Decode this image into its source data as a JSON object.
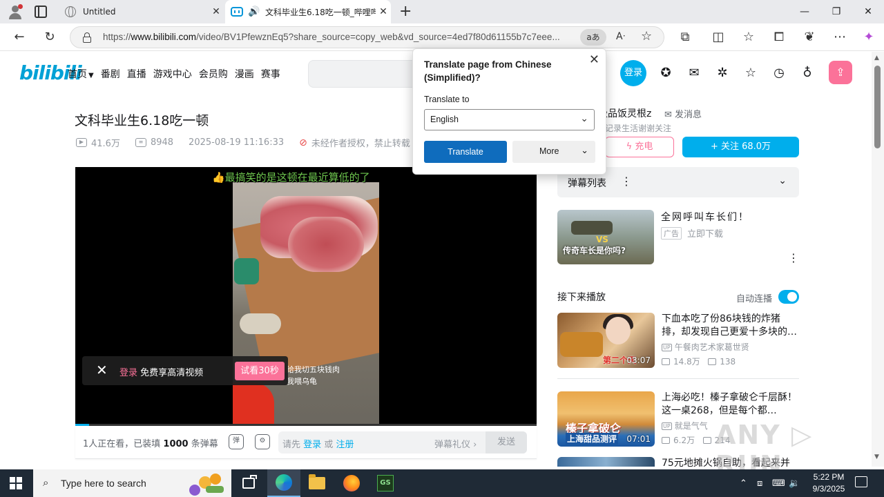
{
  "browser": {
    "tabs": [
      {
        "title": "Untitled"
      },
      {
        "title": "文科毕业生6.18吃一顿_哔哩哔"
      }
    ],
    "address": {
      "url_prefix": "https://",
      "url_host": "www.bilibili.com",
      "url_path": "/video/BV1PfewznEq5?share_source=copy_web&vd_source=4ed7f80d61155b7c7eee...",
      "read_aloud": "aあ"
    }
  },
  "site": {
    "logo": "bilibili",
    "nav": [
      "首页",
      "番剧",
      "直播",
      "游戏中心",
      "会员购",
      "漫画",
      "赛事"
    ],
    "login": "登录"
  },
  "video": {
    "title": "文科毕业生6.18吃一顿",
    "views": "41.6万",
    "danmaku_count": "8948",
    "datetime": "2025-08-19 11:16:33",
    "copyright": "未经作者授权，禁止转载",
    "overlay_danmaku": "👍最搞笑的是这顿在最近算低的了",
    "subtitle_line1": "给我切五块钱肉",
    "subtitle_line2": "我喂乌龟",
    "login_banner_prefix": "登录",
    "login_banner_text": "免费享高清视频",
    "try_button": "试看30秒",
    "progress_fraction": 0.03
  },
  "danmaku_bar": {
    "viewers_prefix": "1人正在看，已装填",
    "viewers_count": "1000",
    "viewers_suffix": "条弹幕",
    "input_prefix": "请先",
    "input_login": "登录",
    "input_or": "或",
    "input_register": "注册",
    "gift": "弹幕礼仪 ›",
    "send": "发送"
  },
  "uploader": {
    "name": "极品饭灵根z",
    "message": "发消息",
    "desc": "记录生活谢谢关注",
    "charge": "充电",
    "follow": "+ 关注 68.0万"
  },
  "sidebar": {
    "danmaku_list": "弹幕列表",
    "ad": {
      "title": "全网呼叫车长们！",
      "badge": "广告",
      "download": "立即下载",
      "thumb_vs": "VS",
      "thumb_caption": "传奇车长是你吗?"
    },
    "next_label": "接下来播放",
    "autoplay_label": "自动连播",
    "autoplay_on": true,
    "recommendations": [
      {
        "title": "下血本吃了份86块钱的炸猪排，却发现自己更爱十多块的…",
        "owner": "午餐肉艺术家葛世贤",
        "views": "14.8万",
        "danmaku": "138",
        "duration": "03:07",
        "thumb_caption": "第二个天"
      },
      {
        "title": "上海必吃！榛子拿破仑千层酥！这一桌268，但是每个都…",
        "owner": "就是气气",
        "views": "6.2万",
        "danmaku": "214",
        "duration": "07:01",
        "thumb_caption1": "榛子拿破仑",
        "thumb_caption2": "上海甜品测评"
      },
      {
        "title": "75元地摊火锅自助，看起来并"
      }
    ]
  },
  "translate_popup": {
    "heading": "Translate page from Chinese (Simplified)?",
    "translate_to_label": "Translate to",
    "language": "English",
    "translate_button": "Translate",
    "more_button": "More"
  },
  "taskbar": {
    "search_placeholder": "Type here to search",
    "time": "5:22 PM",
    "date": "9/3/2025"
  },
  "watermark": "ANY ▷ RUN",
  "colors": {
    "bili_blue": "#00aeec",
    "bili_pink": "#fb7299",
    "edge_blue": "#0f6cbd"
  }
}
